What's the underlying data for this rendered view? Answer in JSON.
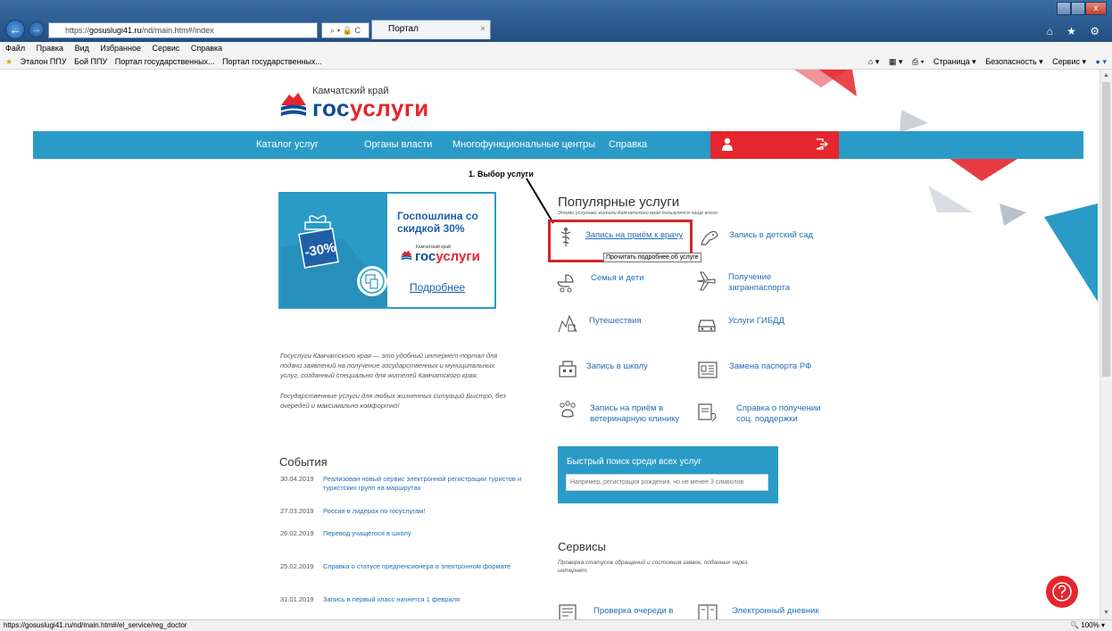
{
  "browser": {
    "url_prefix": "https://",
    "url_host": "gosuslugi41.ru",
    "url_path": "/nd/main.htm#/index",
    "url_tools": "⌕ ▾ 🔒 C",
    "tab_title": "Портал государственных ...",
    "tab_close": "×",
    "back": "←",
    "forward": "→",
    "right_icons": "⌂ ★ ⚙",
    "menu": [
      "Файл",
      "Правка",
      "Вид",
      "Избранное",
      "Сервис",
      "Справка"
    ],
    "favorites": [
      "Эталон ППУ",
      "Бой ППУ",
      "Портал государственных...",
      "Портал государственных..."
    ],
    "commands": [
      "Страница ▾",
      "Безопасность ▾",
      "Сервис ▾"
    ],
    "status_url": "https://gosuslugi41.ru/nd/main.htm#/el_service/reg_doctor",
    "zoom": "100%"
  },
  "header": {
    "region": "Камчатский край",
    "brand_main": "гос",
    "brand_accent": "услуги"
  },
  "nav": {
    "items": [
      "Каталог услуг",
      "Органы власти",
      "Многофункциональные центры",
      "Справка"
    ]
  },
  "banner": {
    "title": "Госпошлина со скидкой 30%",
    "discount": "-30%",
    "logo_region": "Камчатский край",
    "logo_main": "гос",
    "logo_accent": "услуги",
    "more": "Подробнее"
  },
  "about": {
    "p1": "Госуслуги Камчатского края — это удобный интернет-портал для подачи заявлений на получение государственных и муниципальных услуг, созданный специально для жителей Камчатского края.",
    "p2": "Государственные услуги для любых жизненных ситуаций Быстро, без очередей и максимально комфортно!"
  },
  "events": {
    "title": "События",
    "items": [
      {
        "date": "30.04.2019",
        "text": "Реализован новый сервис электронной регистрации туристов и туристских групп на маршрутах"
      },
      {
        "date": "27.03.2019",
        "text": "Россия в лидерах по госуслугам!"
      },
      {
        "date": "26.02.2019",
        "text": "Перевод учащегося в школу"
      },
      {
        "date": "25.02.2019",
        "text": "Справка о статусе предпенсионера в электронном формате"
      },
      {
        "date": "31.01.2019",
        "text": "Запись в первый класс начнется 1 февраля"
      }
    ]
  },
  "annotation": {
    "label": "1. Выбор услуги",
    "tooltip": "Прочитать подробнее об услуге"
  },
  "popular": {
    "title": "Популярные услуги",
    "subtitle": "Этими услугами жители Камчатского края пользуются чаще всего",
    "services": [
      {
        "label": "Запись на приём к врачу",
        "icon": "doctor-icon"
      },
      {
        "label": "Запись в детский сад",
        "icon": "kindergarten-icon"
      },
      {
        "label": "Семья и дети",
        "icon": "stroller-icon"
      },
      {
        "label": "Получение загранпаспорта",
        "icon": "airplane-icon"
      },
      {
        "label": "Путешествия",
        "icon": "travel-icon"
      },
      {
        "label": "Услуги ГИБДД",
        "icon": "car-icon"
      },
      {
        "label": "Запись в школу",
        "icon": "school-icon"
      },
      {
        "label": "Замена паспорта РФ",
        "icon": "passport-icon"
      },
      {
        "label": "Запись на приём в ветеринарную клинику",
        "icon": "paw-icon"
      },
      {
        "label": "Справка о получении соц. поддержки",
        "icon": "social-support-icon"
      }
    ]
  },
  "search": {
    "title": "Быстрый поиск среди всех услуг",
    "placeholder": "Например, регистрация рождения, но не менее 3 символов"
  },
  "services": {
    "title": "Сервисы",
    "subtitle": "Проверка статусов обращений и состояния заявок, поданных через интернет.",
    "items": [
      {
        "label": "Проверка очереди в",
        "icon": "queue-icon"
      },
      {
        "label": "Электронный дневник",
        "icon": "diary-icon"
      }
    ]
  },
  "colors": {
    "nav": "#2a9bc6",
    "accent_red": "#e5262e",
    "brand_blue": "#0d4c9a",
    "link": "#1f6db5"
  }
}
